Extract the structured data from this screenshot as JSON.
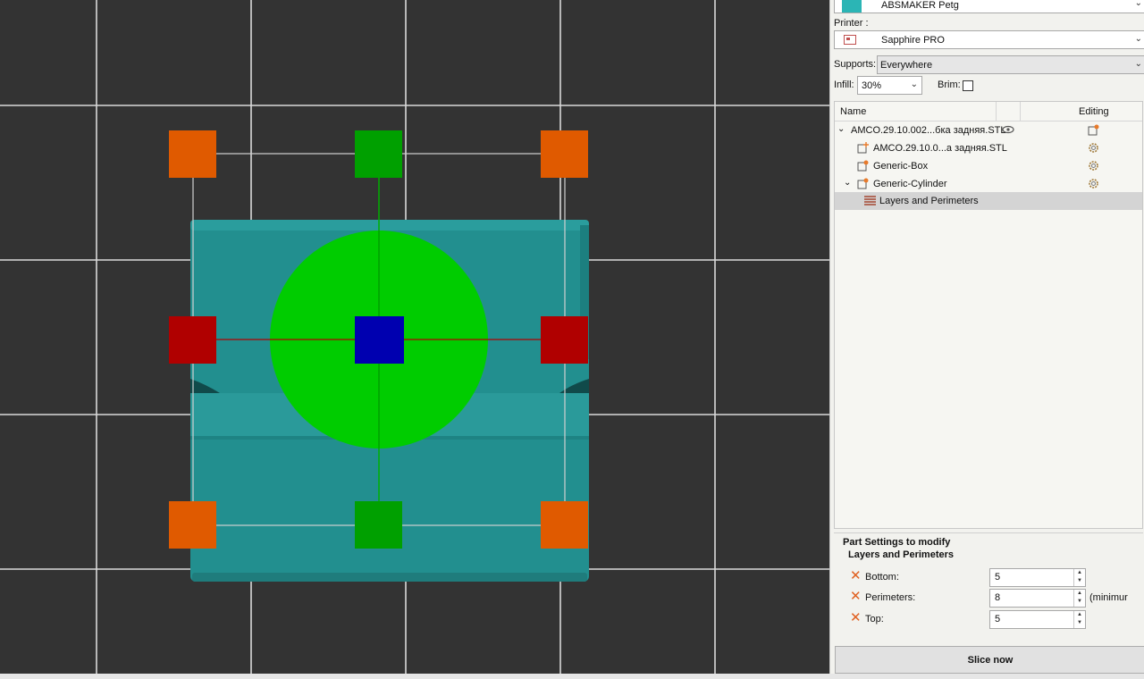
{
  "filament": {
    "name": "ABSMAKER Petg",
    "swatch_color": "#2bb5b5"
  },
  "printer": {
    "label": "Printer :",
    "name": "Sapphire PRO"
  },
  "supports": {
    "label": "Supports:",
    "value": "Everywhere"
  },
  "infill": {
    "label": "Infill:",
    "value": "30%"
  },
  "brim": {
    "label": "Brim:",
    "checked": false
  },
  "object_list": {
    "col_name": "Name",
    "col_editing": "Editing",
    "rows": [
      {
        "label": "AMCO.29.10.002...бка задняя.STL",
        "icon": "expanded-chevron-icon"
      },
      {
        "label": "AMCO.29.10.0...а задняя.STL",
        "icon": "part-icon"
      },
      {
        "label": "Generic-Box",
        "icon": "modifier-icon"
      },
      {
        "label": "Generic-Cylinder",
        "icon": "modifier-icon"
      },
      {
        "label": "Layers and Perimeters",
        "icon": "layers-icon"
      }
    ]
  },
  "part_settings": {
    "title": "Part Settings to modify",
    "group": "Layers and Perimeters",
    "fields": [
      {
        "label": "Bottom:",
        "value": "5"
      },
      {
        "label": "Perimeters:",
        "value": "8",
        "note": "(minimur"
      },
      {
        "label": "Top:",
        "value": "5"
      }
    ]
  },
  "slice_button": {
    "label": "Slice now"
  },
  "colors": {
    "viewport_bg": "#333333",
    "model": "#228f8f",
    "gizmo_corner": "#e05a00",
    "gizmo_y": "#00a000",
    "gizmo_x": "#b00000",
    "gizmo_z": "#0000b0",
    "rotate_circle": "#00cc00"
  }
}
